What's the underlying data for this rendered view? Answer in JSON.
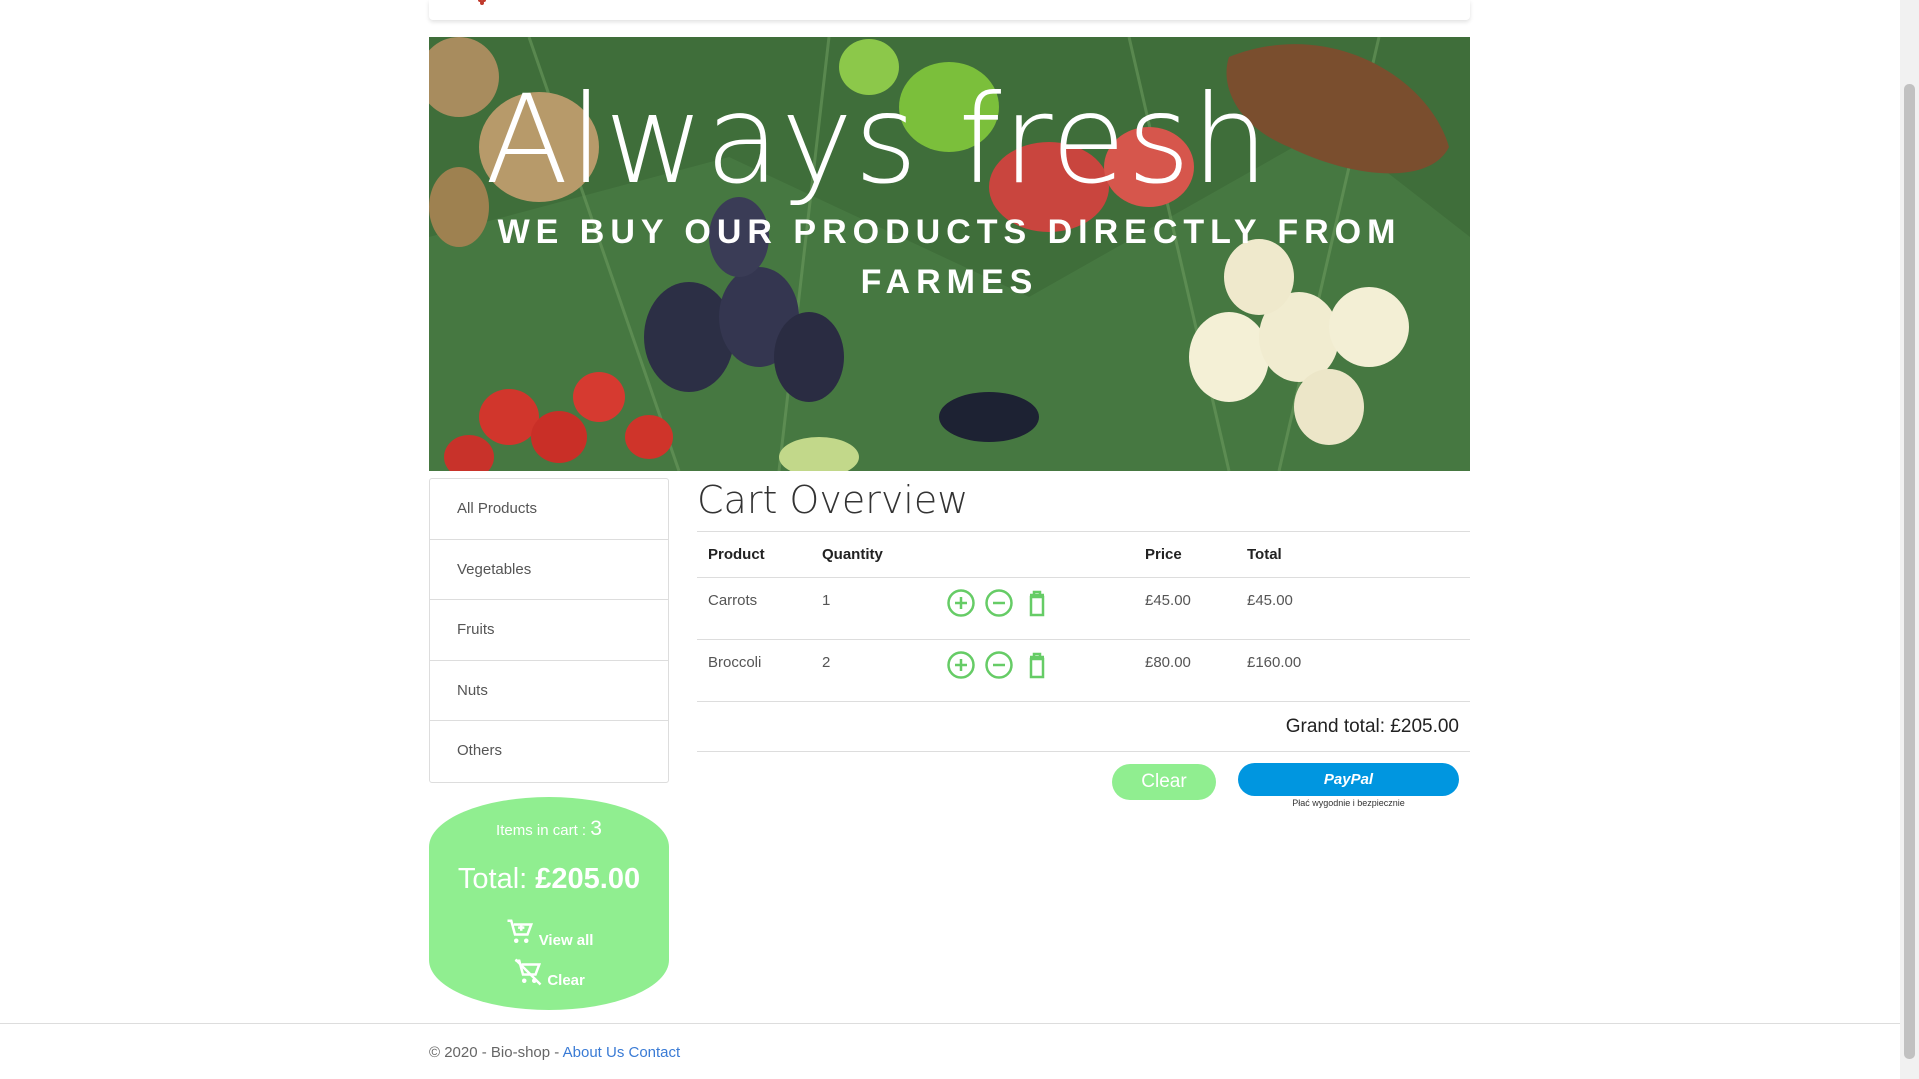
{
  "hero": {
    "title": "Always fresh",
    "subtitle": "WE BUY OUR PRODUCTS DIRECTLY FROM FARMES"
  },
  "categories": [
    {
      "label": "All Products"
    },
    {
      "label": "Vegetables"
    },
    {
      "label": "Fruits"
    },
    {
      "label": "Nuts"
    },
    {
      "label": "Others"
    }
  ],
  "cart_summary": {
    "items_label": "Items in cart : ",
    "items_count": "3",
    "total_label": "Total: ",
    "total_value": "£205.00",
    "view_all": "View all",
    "clear": "Clear"
  },
  "cart": {
    "title": "Cart Overview",
    "columns": [
      "Product",
      "Quantity",
      "",
      "Price",
      "Total"
    ],
    "rows": [
      {
        "product": "Carrots",
        "quantity": "1",
        "price": "£45.00",
        "total": "£45.00"
      },
      {
        "product": "Broccoli",
        "quantity": "2",
        "price": "£80.00",
        "total": "£160.00"
      }
    ],
    "grand_total": "Grand total: £205.00",
    "clear_button": "Clear",
    "paypal_button": "PayPal",
    "paypal_tagline": "Płać wygodnie i bezpiecznie"
  },
  "footer": {
    "copyright": "© 2020 - Bio-shop - ",
    "about": "About Us",
    "contact": "Contact"
  },
  "colors": {
    "accent_green": "#90ee90",
    "icon_green": "#66cc66",
    "paypal_blue": "#0096e0",
    "link_blue": "#3a7bd5"
  }
}
